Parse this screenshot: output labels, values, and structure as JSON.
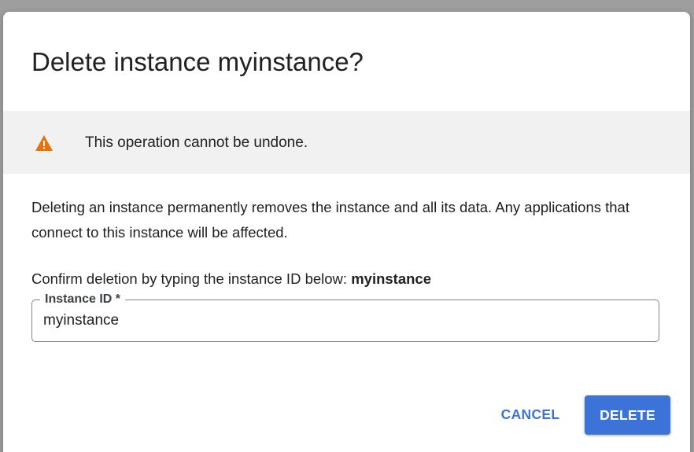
{
  "dialog": {
    "title": "Delete instance myinstance?",
    "warning": {
      "icon": "warning-icon",
      "icon_color": "#e8710a",
      "text": "This operation cannot be undone."
    },
    "description": "Deleting an instance permanently removes the instance and all its data. Any applications that connect to this instance will be affected.",
    "confirm_prompt": "Confirm deletion by typing the instance ID below:",
    "confirm_id": "myinstance",
    "field": {
      "label": "Instance ID *",
      "value": "myinstance"
    },
    "actions": {
      "cancel_label": "CANCEL",
      "delete_label": "DELETE"
    }
  },
  "colors": {
    "accent": "#3b73d9",
    "backdrop": "#9e9e9e",
    "banner": "#f1f1f1"
  }
}
